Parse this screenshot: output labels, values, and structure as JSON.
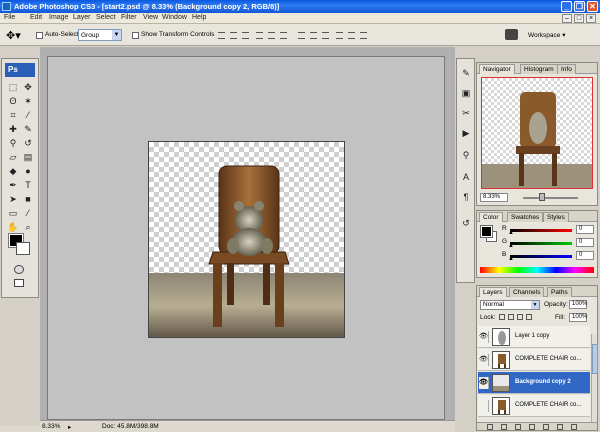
{
  "window": {
    "title": "Adobe Photoshop CS3 - [start2.psd @ 8.33% (Background copy 2, RGB/8)]",
    "minimize": "_",
    "restore": "❐",
    "close": "✕"
  },
  "menu": {
    "items": [
      "File",
      "Edit",
      "Image",
      "Layer",
      "Select",
      "Filter",
      "View",
      "Window",
      "Help"
    ]
  },
  "options": {
    "auto_select_label": "Auto-Select:",
    "auto_select_value": "Group",
    "show_transform_label": "Show Transform Controls",
    "workspace_label": "Workspace ▾"
  },
  "toolbox": {
    "logo": "Ps"
  },
  "status": {
    "zoom": "8.33%",
    "doc": "Doc: 45.8M/398.8M"
  },
  "navigator": {
    "tabs": [
      "Navigator",
      "Histogram",
      "Info"
    ],
    "zoom": "8.33%"
  },
  "color": {
    "tabs": [
      "Color",
      "Swatches",
      "Styles"
    ],
    "channels": [
      {
        "label": "R",
        "value": "0"
      },
      {
        "label": "G",
        "value": "0"
      },
      {
        "label": "B",
        "value": "0"
      }
    ]
  },
  "layers": {
    "tabs": [
      "Layers",
      "Channels",
      "Paths"
    ],
    "blend_mode": "Normal",
    "opacity_label": "Opacity:",
    "opacity_value": "100%",
    "lock_label": "Lock:",
    "fill_label": "Fill:",
    "fill_value": "100%",
    "rows": [
      {
        "name": "Layer 1 copy",
        "visible": true,
        "selected": false
      },
      {
        "name": "COMPLETE CHAIR co...",
        "visible": true,
        "selected": false
      },
      {
        "name": "Background copy 2",
        "visible": true,
        "selected": true
      },
      {
        "name": "COMPLETE CHAIR co...",
        "visible": false,
        "selected": false
      }
    ]
  },
  "colors": {
    "titlebar": "#0a58e0",
    "selection": "#3168c6",
    "nav_frame": "#e03030",
    "wood": "#8a5a2b"
  }
}
